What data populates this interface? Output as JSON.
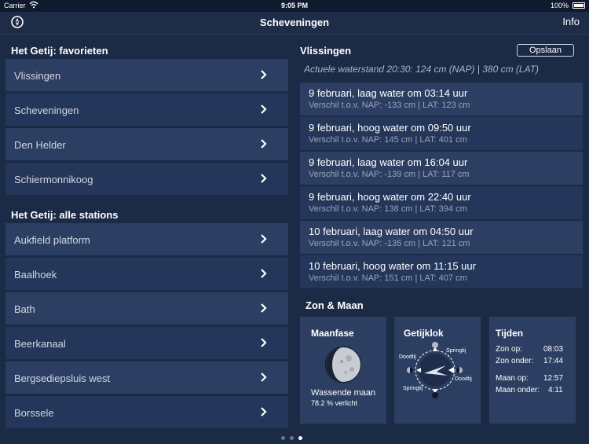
{
  "status": {
    "carrier": "Carrier",
    "time": "9:05 PM",
    "battery": "100%"
  },
  "nav": {
    "title": "Scheveningen",
    "info": "Info"
  },
  "favorites": {
    "title": "Het Getij: favorieten",
    "items": [
      "Vlissingen",
      "Scheveningen",
      "Den Helder",
      "Schiermonnikoog"
    ]
  },
  "stations": {
    "title": "Het Getij: alle stations",
    "items": [
      "Aukfield platform",
      "Baalhoek",
      "Bath",
      "Beerkanaal",
      "Bergsediepsluis west",
      "Borssele"
    ]
  },
  "detail": {
    "title": "Vlissingen",
    "save": "Opslaan",
    "actual": "Actuele waterstand 20:30: 124 cm (NAP) | 380 cm (LAT)",
    "tides": [
      {
        "main": "9 februari, laag water om 03:14 uur",
        "sub": "Verschil t.o.v. NAP: -133 cm | LAT: 123 cm"
      },
      {
        "main": "9 februari, hoog water om 09:50 uur",
        "sub": "Verschil t.o.v. NAP: 145 cm | LAT: 401 cm"
      },
      {
        "main": "9 februari, laag water om 16:04 uur",
        "sub": "Verschil t.o.v. NAP: -139 cm | LAT: 117 cm"
      },
      {
        "main": "9 februari, hoog water om 22:40 uur",
        "sub": "Verschil t.o.v. NAP: 138 cm | LAT: 394 cm"
      },
      {
        "main": "10 februari, laag water om 04:50 uur",
        "sub": "Verschil t.o.v. NAP: -135 cm | LAT: 121 cm"
      },
      {
        "main": "10 februari, hoog water om 11:15 uur",
        "sub": "Verschil t.o.v. NAP: 151 cm | LAT: 407 cm"
      }
    ]
  },
  "zonmaan": {
    "title": "Zon & Maan",
    "maanfase": {
      "title": "Maanfase",
      "label": "Wassende maan",
      "pct": "78.2 % verlicht"
    },
    "getijklok": {
      "title": "Getijklok",
      "springtij": "Springtij",
      "doodtij": "Doodtij"
    },
    "tijden": {
      "title": "Tijden",
      "rows": [
        {
          "label": "Zon op:",
          "value": "08:03"
        },
        {
          "label": "Zon onder:",
          "value": "17:44"
        },
        {
          "label": "Maan op:",
          "value": "12:57"
        },
        {
          "label": "Maan onder:",
          "value": "4:11"
        }
      ]
    }
  }
}
